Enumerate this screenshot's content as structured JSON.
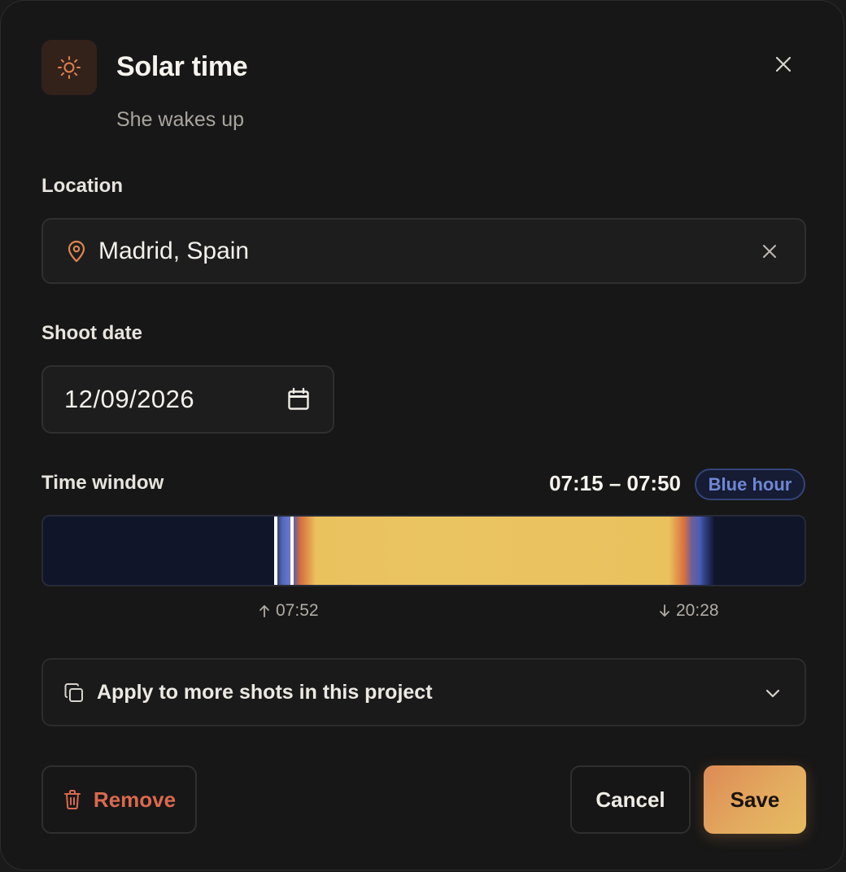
{
  "dialog": {
    "title": "Solar time",
    "subtitle": "She wakes up",
    "header_icon": "sun-icon",
    "close_icon": "close-icon"
  },
  "location": {
    "label": "Location",
    "value": "Madrid, Spain",
    "icon": "map-pin-icon",
    "clear_icon": "close-icon"
  },
  "shoot_date": {
    "label": "Shoot date",
    "value": "12/09/2026",
    "icon": "calendar-icon"
  },
  "time_window": {
    "label": "Time window",
    "range": "07:15 – 07:50",
    "badge": "Blue hour",
    "sunrise": "07:52",
    "sunset": "20:28",
    "sunrise_icon": "arrow-up-icon",
    "sunset_icon": "arrow-down-icon",
    "colors": {
      "night": "#10152a",
      "blue_hour": "#5b6cc0",
      "golden_hour": "#d8703f",
      "day": "#ebc462"
    }
  },
  "apply": {
    "label": "Apply to more shots in this project",
    "icon": "copy-icon",
    "chevron_icon": "chevron-down-icon"
  },
  "actions": {
    "remove_label": "Remove",
    "remove_icon": "trash-icon",
    "cancel_label": "Cancel",
    "save_label": "Save"
  },
  "colors": {
    "accent": "#e3a45c",
    "danger": "#d9694f",
    "badge_text": "#6f86d4"
  }
}
